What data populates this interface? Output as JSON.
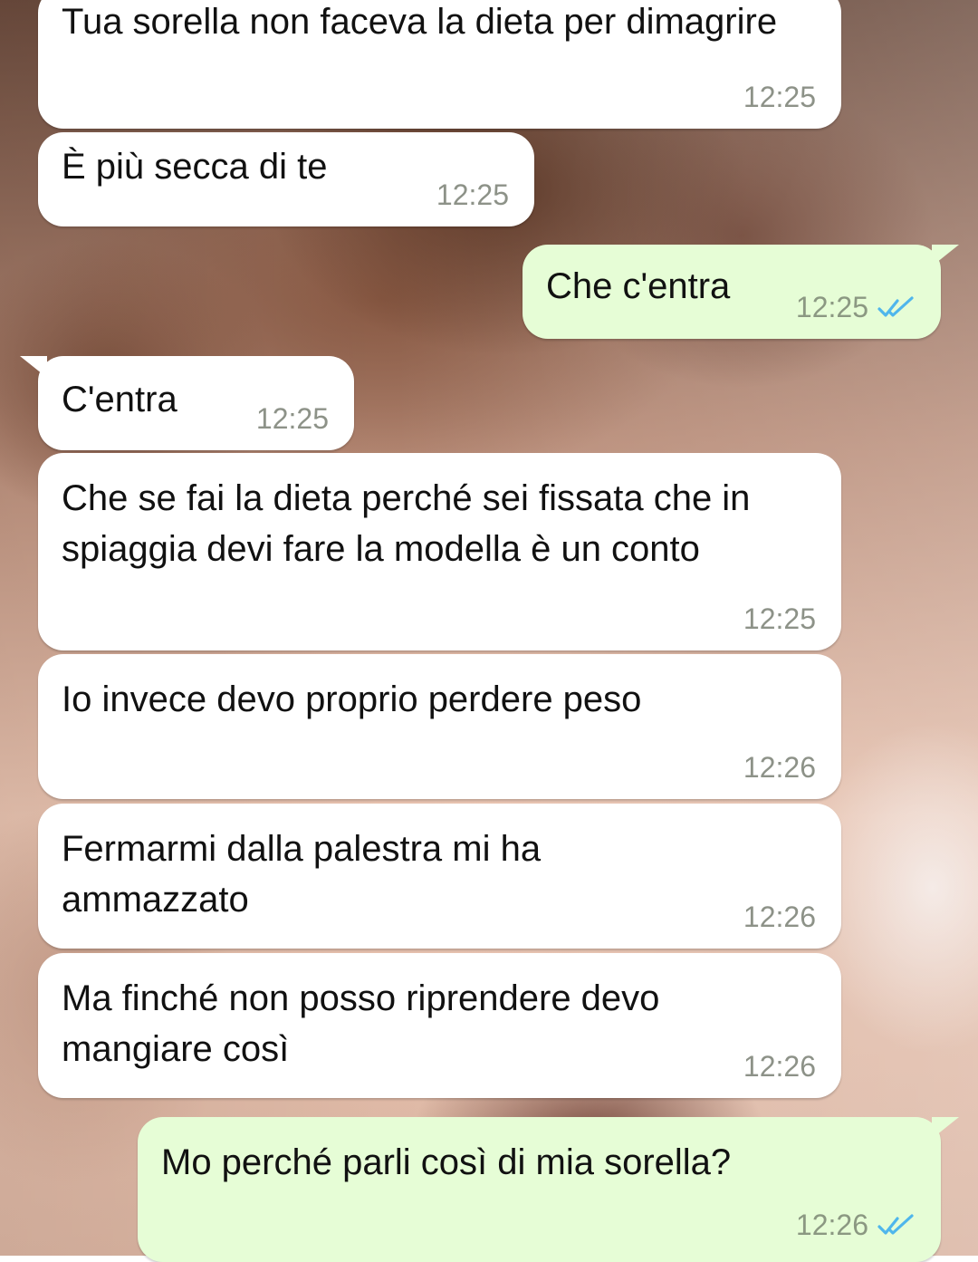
{
  "messages": [
    {
      "dir": "in",
      "text": "Tua sorella non faceva la dieta per dimagrire",
      "time": "12:25"
    },
    {
      "dir": "in",
      "text": "È più secca di te",
      "time": "12:25"
    },
    {
      "dir": "out",
      "text": "Che c'entra",
      "time": "12:25",
      "status": "read"
    },
    {
      "dir": "in",
      "text": "C'entra",
      "time": "12:25"
    },
    {
      "dir": "in",
      "text": "Che se fai la dieta perché sei fissata che in spiaggia devi fare la modella è un conto",
      "time": "12:25"
    },
    {
      "dir": "in",
      "text": "Io invece devo proprio perdere peso",
      "time": "12:26"
    },
    {
      "dir": "in",
      "text": "Fermarmi dalla palestra mi ha ammazzato",
      "time": "12:26"
    },
    {
      "dir": "in",
      "text": "Ma finché non posso riprendere devo mangiare così",
      "time": "12:26"
    },
    {
      "dir": "out",
      "text": "Mo perché parli così di mia sorella?",
      "time": "12:26",
      "status": "read"
    }
  ],
  "colors": {
    "incoming_bubble": "#ffffff",
    "outgoing_bubble": "#e6fdd6",
    "read_ticks": "#4fb6ec",
    "timestamp": "#8d9288"
  },
  "icons": {
    "read_status": "double-check-icon"
  }
}
